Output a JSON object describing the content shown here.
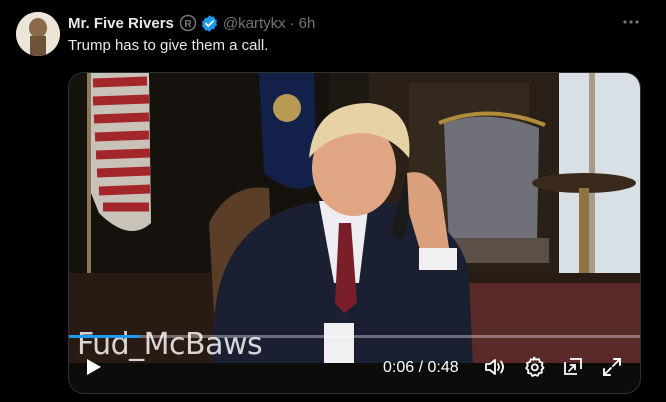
{
  "author": {
    "name": "Mr. Five Rivers",
    "handle": "@kartykx",
    "time": "6h",
    "separator": "·"
  },
  "tweet": {
    "text": "Trump has to give them a call."
  },
  "video": {
    "watermark": "Fud_McBaws",
    "current_time": "0:06",
    "duration": "0:48",
    "time_display": "0:06 / 0:48",
    "progress_fraction": 0.125
  },
  "icons": {
    "more": "more-horizontal-icon",
    "registered": "registered-mark-icon",
    "verified": "verified-badge-icon",
    "play": "play-icon",
    "volume": "volume-icon",
    "settings": "settings-gear-icon",
    "pip": "picture-in-picture-icon",
    "fullscreen": "fullscreen-icon"
  },
  "colors": {
    "background": "#000000",
    "text_primary": "#e7e9ea",
    "text_secondary": "#71767b",
    "verified_blue": "#1d9bf0"
  }
}
